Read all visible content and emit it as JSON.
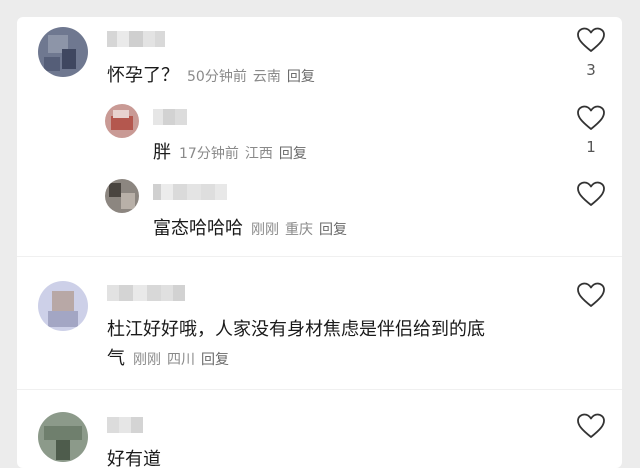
{
  "comments": [
    {
      "text": "怀孕了？",
      "time": "50分钟前",
      "location": "云南",
      "reply": "回复",
      "likes": "3",
      "icon": "heart-outline-icon"
    },
    {
      "text": "胖",
      "time": "17分钟前",
      "location": "江西",
      "reply": "回复",
      "likes": "1",
      "icon": "heart-outline-icon"
    },
    {
      "text": "富态哈哈哈",
      "time": "刚刚",
      "location": "重庆",
      "reply": "回复",
      "likes": "",
      "icon": "heart-outline-icon"
    },
    {
      "text_line1": "杜江好好哦，人家没有身材焦虑是伴侣给到的底",
      "text_line2": "气",
      "time": "刚刚",
      "location": "四川",
      "reply": "回复",
      "likes": "",
      "icon": "heart-outline-icon"
    },
    {
      "text": "好有道",
      "likes": "",
      "icon": "heart-outline-icon"
    }
  ],
  "colors": {
    "text": "#1a1a1a",
    "meta": "#8a8a8a",
    "background": "#ffffff"
  }
}
